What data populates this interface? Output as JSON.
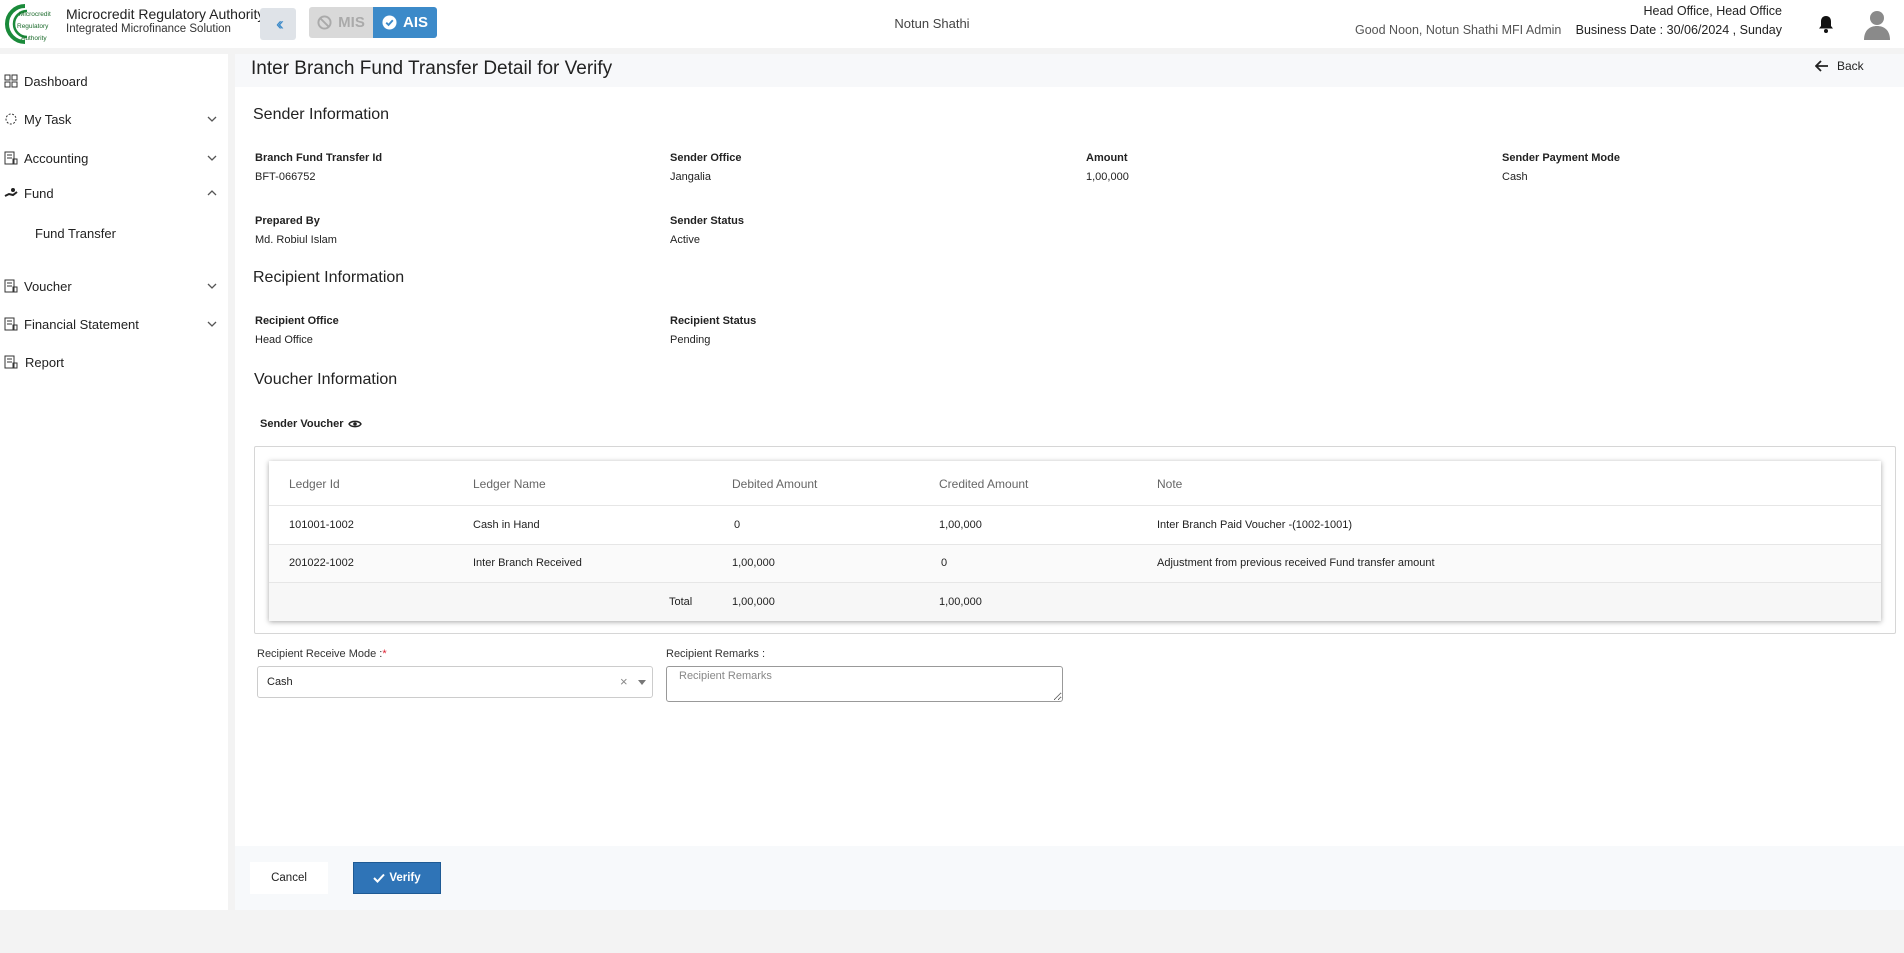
{
  "header": {
    "brand_title": "Microcredit Regulatory Authority",
    "brand_subtitle": "Integrated Microfinance Solution",
    "logo_text": [
      "Microcredit",
      "Regulatory",
      "Authority"
    ],
    "mis_label": "MIS",
    "ais_label": "AIS",
    "center_name": "Notun Shathi",
    "greeting": "Good Noon, Notun Shathi MFI Admin",
    "office": "Head Office, Head Office",
    "business_date": "Business Date : 30/06/2024 , Sunday"
  },
  "sidebar": {
    "items": [
      {
        "label": "Dashboard"
      },
      {
        "label": "My Task"
      },
      {
        "label": "Accounting"
      },
      {
        "label": "Fund"
      },
      {
        "label": "Voucher"
      },
      {
        "label": "Financial Statement"
      },
      {
        "label": "Report"
      }
    ],
    "fund_sub": [
      "Fund Transfer"
    ]
  },
  "page": {
    "title": "Inter Branch Fund Transfer Detail for Verify",
    "back_label": "Back"
  },
  "sender": {
    "section_title": "Sender Information",
    "fields": [
      {
        "label": "Branch Fund Transfer Id",
        "value": "BFT-066752"
      },
      {
        "label": "Sender Office",
        "value": "Jangalia"
      },
      {
        "label": "Amount",
        "value": "1,00,000"
      },
      {
        "label": "Sender Payment Mode",
        "value": "Cash"
      },
      {
        "label": "Prepared By",
        "value": "Md. Robiul Islam"
      },
      {
        "label": "Sender Status",
        "value": "Active"
      }
    ]
  },
  "recipient": {
    "section_title": "Recipient Information",
    "fields": [
      {
        "label": "Recipient Office",
        "value": "Head Office"
      },
      {
        "label": "Recipient Status",
        "value": "Pending"
      }
    ]
  },
  "voucher": {
    "section_title": "Voucher Information",
    "sender_voucher_label": "Sender Voucher",
    "columns": [
      "Ledger Id",
      "Ledger Name",
      "Debited Amount",
      "Credited Amount",
      "Note"
    ],
    "rows": [
      [
        "101001-1002",
        "Cash in Hand",
        "0",
        "1,00,000",
        "Inter Branch Paid Voucher -(1002-1001)"
      ],
      [
        "201022-1002",
        "Inter Branch Received",
        "1,00,000",
        "0",
        "Adjustment from previous received Fund transfer amount"
      ]
    ],
    "total_label": "Total",
    "total_debit": "1,00,000",
    "total_credit": "1,00,000"
  },
  "form": {
    "receive_mode_label": "Recipient Receive Mode :",
    "required_mark": "*",
    "receive_mode_value": "Cash",
    "clear_symbol": "×",
    "remarks_label": "Recipient Remarks :",
    "remarks_placeholder": "Recipient Remarks"
  },
  "footer": {
    "cancel_label": "Cancel",
    "verify_label": "Verify"
  },
  "colors": {
    "primary": "#3c8ac9",
    "verify": "#2f74b7",
    "logo_green": "#1a8a3a"
  }
}
